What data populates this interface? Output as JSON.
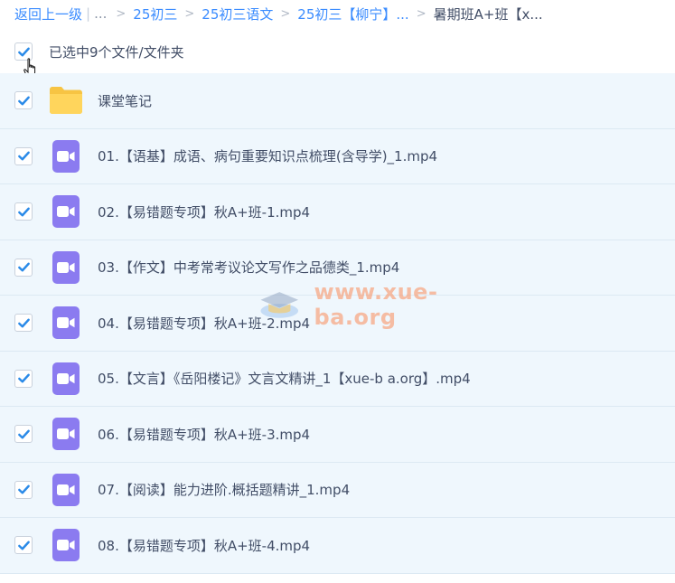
{
  "breadcrumb": {
    "back": "返回上一级",
    "ellipsis": "...",
    "items": [
      "25初三",
      "25初三语文",
      "25初三【柳宁】..."
    ],
    "current": "暑期班A+班【x..."
  },
  "selection": {
    "label": "已选中9个文件/文件夹"
  },
  "files": [
    {
      "name": "课堂笔记",
      "type": "folder"
    },
    {
      "name": "01.【语基】成语、病句重要知识点梳理(含导学)_1.mp4",
      "type": "video"
    },
    {
      "name": "02.【易错题专项】秋A+班-1.mp4",
      "type": "video"
    },
    {
      "name": "03.【作文】中考常考议论文写作之品德类_1.mp4",
      "type": "video"
    },
    {
      "name": "04.【易错题专项】秋A+班-2.mp4",
      "type": "video"
    },
    {
      "name": "05.【文言】《岳阳楼记》文言文精讲_1【xue-b a.org】.mp4",
      "type": "video"
    },
    {
      "name": "06.【易错题专项】秋A+班-3.mp4",
      "type": "video"
    },
    {
      "name": "07.【阅读】能力进阶.概括题精讲_1.mp4",
      "type": "video"
    },
    {
      "name": "08.【易错题专项】秋A+班-4.mp4",
      "type": "video"
    }
  ],
  "watermark": {
    "text": "www.xue-ba.org"
  },
  "colors": {
    "link": "#3b8cff",
    "check": "#2a8ae8",
    "row_bg": "#eff7fd",
    "video_icon": "#8b7bf0",
    "folder": "#ffd55c"
  }
}
